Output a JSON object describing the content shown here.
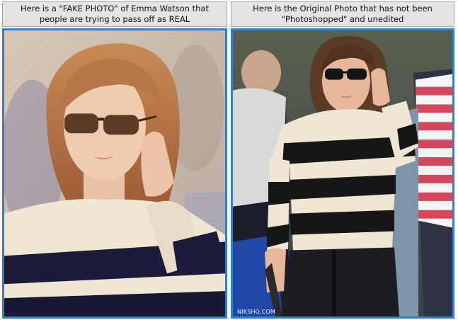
{
  "left": {
    "caption_line1": "Here is a \"FAKE PHOTO\" of Emma Watson that",
    "caption_line2": "people are trying to pass off as REAL"
  },
  "right": {
    "caption_line1": "Here is the Original Photo that has not been",
    "caption_line2": "\"Photoshopped\" and unedited",
    "watermark": "NIKSHO.COM"
  },
  "colors": {
    "frame_border": "#2f7fd4",
    "caption_bg": "#e4e4e4"
  }
}
